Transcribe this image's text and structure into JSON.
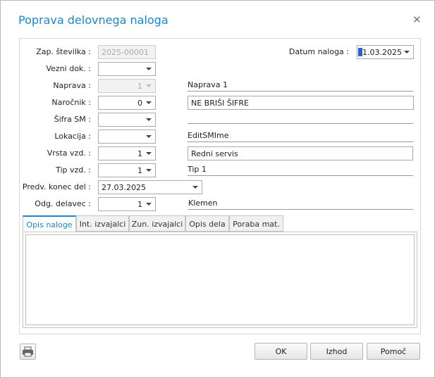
{
  "dialog": {
    "title": "Poprava delovnega naloga"
  },
  "fields": {
    "zap_stevilka": {
      "label": "Zap. številka :",
      "value": "2025-00001"
    },
    "vezni_dok": {
      "label": "Vezni dok. :",
      "value": ""
    },
    "naprava": {
      "label": "Naprava :",
      "value": "1",
      "text": "Naprava 1"
    },
    "narocnik": {
      "label": "Naročnik :",
      "value": "0",
      "text": "NE BRIŠI ŠIFRE"
    },
    "sifra_sm": {
      "label": "Šifra SM :",
      "value": "",
      "text": ""
    },
    "lokacija": {
      "label": "Lokacija :",
      "value": "",
      "text": "EditSMIme"
    },
    "vrsta_vzd": {
      "label": "Vrsta vzd. :",
      "value": "1",
      "text": "Redni servis"
    },
    "tip_vzd": {
      "label": "Tip vzd. :",
      "value": "1",
      "text": "Tip 1"
    },
    "predv_konec": {
      "label": "Predv. konec del :",
      "value": "27.03.2025"
    },
    "odg_delavec": {
      "label": "Odg. delavec :",
      "value": "1",
      "text": "Klemen"
    },
    "datum_naloga": {
      "label": "Datum naloga :",
      "value": "1.03.2025",
      "cursor_char": "2"
    }
  },
  "tabs": [
    {
      "label": "Opis naloge"
    },
    {
      "label": "Int. izvajalci"
    },
    {
      "label": "Zun. izvajalci"
    },
    {
      "label": "Opis dela"
    },
    {
      "label": "Poraba mat."
    }
  ],
  "buttons": {
    "ok": "OK",
    "izhod": "Izhod",
    "pomoc": "Pomoč"
  },
  "colors": {
    "accent": "#1e86c8"
  },
  "icons": {
    "close": "close-icon",
    "print": "printer-icon",
    "dropdown": "chevron-down-icon"
  }
}
